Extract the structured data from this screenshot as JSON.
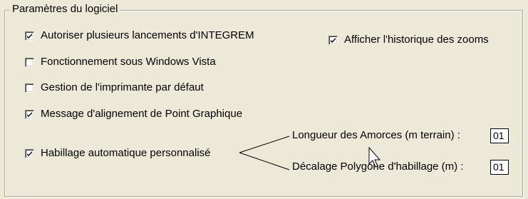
{
  "group": {
    "title": "Paramètres du logiciel"
  },
  "checkboxes": [
    {
      "label": "Autoriser plusieurs lancements d'INTEGREM",
      "checked": true
    },
    {
      "label": "Fonctionnement sous Windows Vista",
      "checked": false
    },
    {
      "label": "Gestion de l'imprimante par défaut",
      "checked": false
    },
    {
      "label": "Message d'alignement de Point Graphique",
      "checked": true
    },
    {
      "label": "Habillage automatique personnalisé",
      "checked": true
    },
    {
      "label": "Afficher l'historique des zooms",
      "checked": true
    }
  ],
  "fields": {
    "amorces": {
      "label": "Longueur des Amorces (m terrain) :",
      "value": "01"
    },
    "decalage": {
      "label": "Décalage Polygone d'habillage (m) :",
      "value": "01"
    }
  },
  "icons": {
    "checkmark": "checkmark-icon",
    "cursor": "mouse-pointer-icon"
  },
  "colors": {
    "background": "#ece9d8",
    "group_border": "#aca899",
    "checkbox_fill": "#ffffff"
  }
}
